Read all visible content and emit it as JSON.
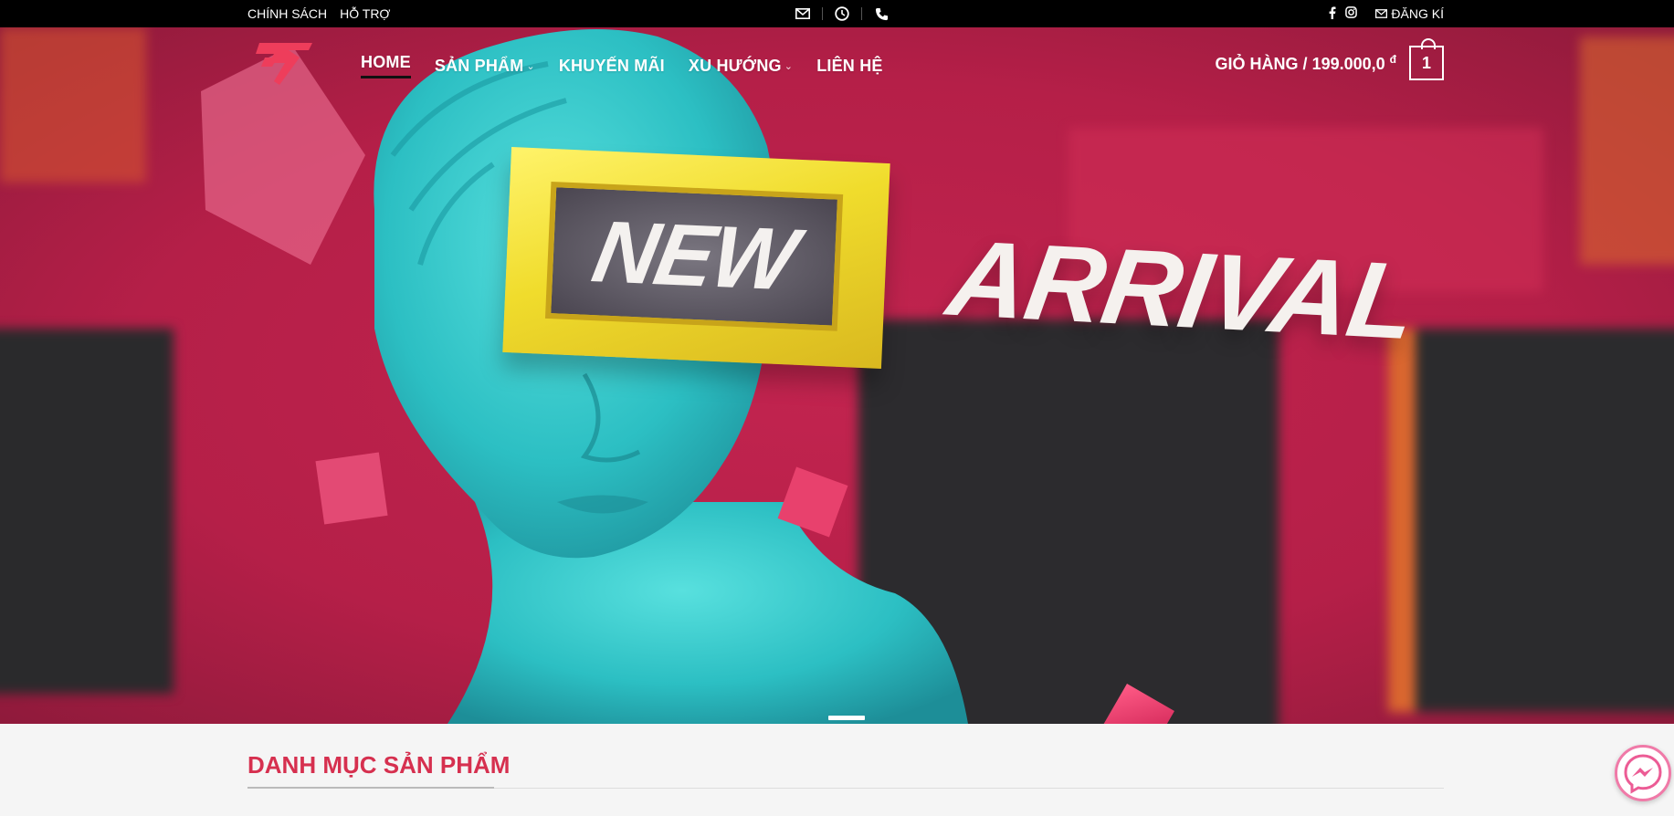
{
  "topbar": {
    "links": [
      "CHÍNH SÁCH",
      "HỖ TRỢ"
    ],
    "register_label": "ĐĂNG KÍ"
  },
  "nav": {
    "items": [
      {
        "label": "HOME",
        "active": true,
        "has_dropdown": false
      },
      {
        "label": "SẢN PHẨM",
        "active": false,
        "has_dropdown": true
      },
      {
        "label": "KHUYẾN MÃI",
        "active": false,
        "has_dropdown": false
      },
      {
        "label": "XU HƯỚNG",
        "active": false,
        "has_dropdown": true
      },
      {
        "label": "LIÊN HỆ",
        "active": false,
        "has_dropdown": false
      }
    ]
  },
  "cart": {
    "label": "GIỎ HÀNG /",
    "amount": "199.000,0",
    "currency": "đ",
    "count": "1"
  },
  "hero": {
    "text_new": "NEW",
    "text_arrival": "ARRIVAL"
  },
  "section": {
    "title": "DANH MỤC SẢN PHẨM"
  },
  "colors": {
    "accent": "#d6304f",
    "hero_background": "#c2244f",
    "statue": "#2fc0c4",
    "frame_yellow": "#f3e43a",
    "topbar": "#000000",
    "messenger_ring": "#f07aa8"
  },
  "icons": {
    "topbar": [
      "mail-icon",
      "clock-icon",
      "phone-icon",
      "facebook-icon",
      "instagram-icon"
    ],
    "chat": "messenger-icon"
  }
}
